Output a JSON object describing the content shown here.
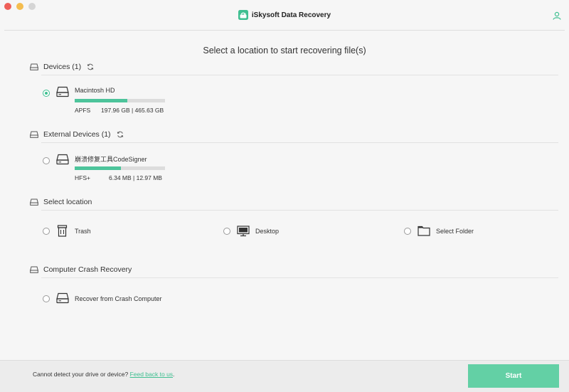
{
  "window": {
    "title": "iSkysoft Data Recovery"
  },
  "headline": "Select a location to start recovering file(s)",
  "sections": {
    "devices": {
      "title": "Devices (1)",
      "items": [
        {
          "name": "Macintosh HD",
          "fs": "APFS",
          "size": "197.96 GB | 465.63 GB",
          "usage_fraction": 0.58,
          "selected": true
        }
      ]
    },
    "external": {
      "title": "External Devices (1)",
      "items": [
        {
          "name": "崩溃修复工具CodeSigner",
          "fs": "HFS+",
          "size": "6.34 MB | 12.97 MB",
          "usage_fraction": 0.51,
          "selected": false
        }
      ]
    },
    "location": {
      "title": "Select location",
      "items": [
        {
          "name": "Trash",
          "icon": "trash-icon"
        },
        {
          "name": "Desktop",
          "icon": "monitor-icon"
        },
        {
          "name": "Select Folder",
          "icon": "folder-icon"
        }
      ]
    },
    "crash": {
      "title": "Computer Crash Recovery",
      "items": [
        {
          "name": "Recover from Crash Computer",
          "icon": "drive-icon"
        }
      ]
    }
  },
  "footer": {
    "message": "Cannot detect your drive or device? ",
    "link": "Feed back to us",
    "suffix": ".",
    "start_label": "Start"
  },
  "colors": {
    "accent": "#3fbf91",
    "button": "#63d0a5",
    "bar_fill": "#4dc49b"
  }
}
